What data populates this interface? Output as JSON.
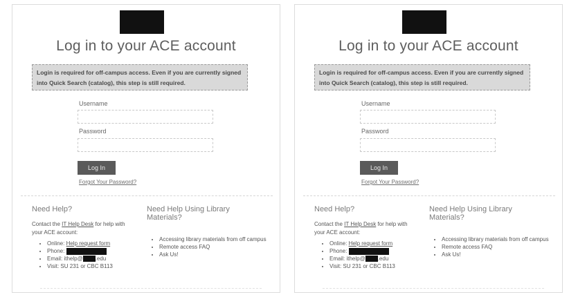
{
  "panels": [
    {
      "title": "Log in to your ACE account",
      "notice": "Login is required for off-campus access. Even if you are currently signed into Quick Search (catalog), this step is still required.",
      "username_label": "Username",
      "password_label": "Password",
      "login_button": "Log In",
      "forgot_link": "Forgot Your Password?",
      "help": {
        "title": "Need Help?",
        "description_prefix": "Contact the ",
        "description_link": "IT Help Desk",
        "description_suffix": " for help with your ACE account:",
        "items": {
          "online_label": "Online: ",
          "online_link": "Help request form",
          "phone_label": "Phone: ",
          "email_prefix": "Email: ithelp@",
          "email_suffix": ".edu",
          "visit": "Visit: SU 231 or CBC B113"
        }
      },
      "library": {
        "title": "Need Help Using Library Materials?",
        "items": [
          "Accessing library materials from off campus",
          "Remote access FAQ",
          "Ask Us!"
        ]
      }
    },
    {
      "title": "Log in to your ACE account",
      "notice": "Login is required for off-campus access. Even if you are currently signed into Quick Search (catalog), this step is still required.",
      "username_label": "Username",
      "password_label": "Password",
      "login_button": "Log In",
      "forgot_link": "Forgot Your Password?",
      "help": {
        "title": "Need Help?",
        "description_prefix": "Contact the ",
        "description_link": "IT Help Desk",
        "description_suffix": " for help with your ACE account:",
        "items": {
          "online_label": "Online: ",
          "online_link": "Help request form",
          "phone_label": "Phone: ",
          "email_prefix": "Email: ithelp@",
          "email_suffix": ".edu",
          "visit": "Visit: SU 231 or CBC B113"
        }
      },
      "library": {
        "title": "Need Help Using Library Materials?",
        "items": [
          "Accessing library materials from off campus",
          "Remote access FAQ",
          "Ask Us!"
        ]
      }
    }
  ]
}
